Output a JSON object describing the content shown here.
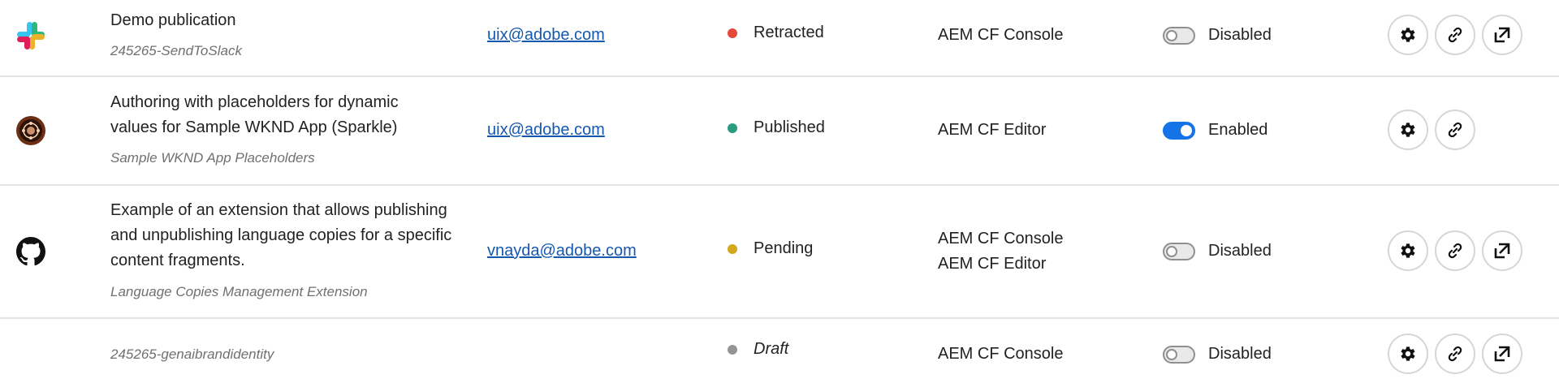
{
  "rows": [
    {
      "icon": "slack-icon",
      "title": "Demo publication",
      "subtitle": "245265-SendToSlack",
      "email": "uix@adobe.com",
      "status": {
        "label": "Retracted",
        "color": "#e34a3c"
      },
      "extension_points": [
        "AEM CF Console"
      ],
      "toggle": {
        "state": "off",
        "label": "Disabled"
      },
      "actions": [
        "gear-icon",
        "link-icon",
        "open-in-icon"
      ]
    },
    {
      "icon": "wknd-app-icon",
      "title_lines": [
        "Authoring with placeholders for dynamic",
        "values for Sample WKND App (Sparkle)"
      ],
      "subtitle": "Sample WKND App Placeholders",
      "email": "uix@adobe.com",
      "status": {
        "label": "Published",
        "color": "#2a9d7f"
      },
      "extension_points": [
        "AEM CF Editor"
      ],
      "toggle": {
        "state": "on",
        "label": "Enabled"
      },
      "actions": [
        "gear-icon",
        "link-icon"
      ]
    },
    {
      "icon": "github-icon",
      "title_lines": [
        "Example of an extension that allows publishing",
        "and unpublishing language copies for a specific",
        "content fragments."
      ],
      "subtitle": "Language Copies Management Extension",
      "email": "vnayda@adobe.com",
      "status": {
        "label": "Pending",
        "color": "#d3a81c"
      },
      "extension_points": [
        "AEM CF Console",
        "AEM CF Editor"
      ],
      "toggle": {
        "state": "off",
        "label": "Disabled"
      },
      "actions": [
        "gear-icon",
        "link-icon",
        "open-in-icon"
      ]
    },
    {
      "icon": "",
      "subtitle": "245265-genaibrandidentity",
      "email": "",
      "status": {
        "label": "Draft",
        "color": "#959595"
      },
      "extension_points": [
        "AEM CF Console"
      ],
      "toggle": {
        "state": "off",
        "label": "Disabled"
      },
      "actions": [
        "gear-icon",
        "link-icon",
        "open-in-icon"
      ]
    }
  ]
}
